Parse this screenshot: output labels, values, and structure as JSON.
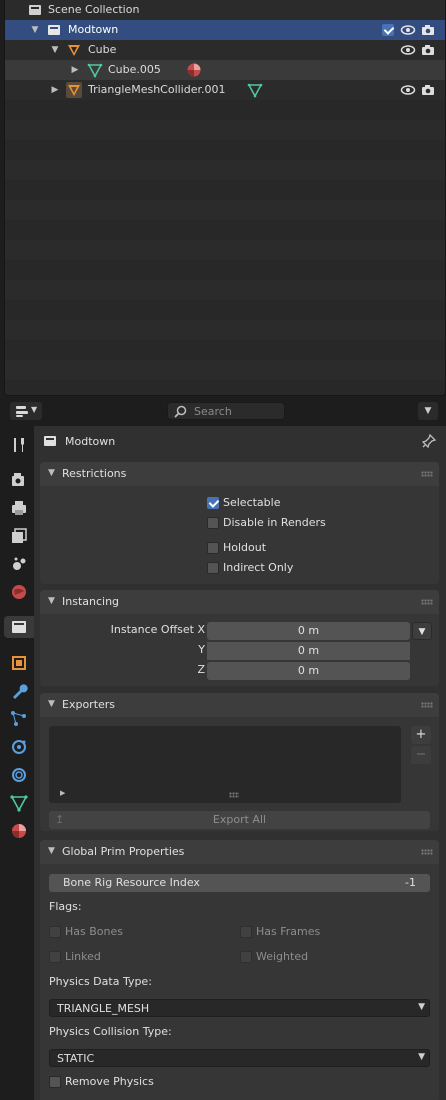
{
  "outliner": {
    "rows": [
      {
        "label": "Scene Collection"
      },
      {
        "label": "Modtown"
      },
      {
        "label": "Cube"
      },
      {
        "label": "Cube.005"
      },
      {
        "label": "TriangleMeshCollider.001"
      }
    ]
  },
  "header": {
    "search_placeholder": "Search"
  },
  "properties": {
    "context_title": "Modtown",
    "restrictions": {
      "title": "Restrictions",
      "selectable": "Selectable",
      "disable_in_renders": "Disable in Renders",
      "holdout": "Holdout",
      "indirect_only": "Indirect Only"
    },
    "instancing": {
      "title": "Instancing",
      "x_label": "Instance Offset X",
      "y_label": "Y",
      "z_label": "Z",
      "x_value": "0 m",
      "y_value": "0 m",
      "z_value": "0 m"
    },
    "exporters": {
      "title": "Exporters",
      "add": "+",
      "remove": "−",
      "export_all": "Export All"
    },
    "global_prim": {
      "title": "Global Prim Properties",
      "bone_rig_label": "Bone Rig Resource Index",
      "bone_rig_value": "-1",
      "flags_label": "Flags:",
      "has_bones": "Has Bones",
      "has_frames": "Has Frames",
      "linked": "Linked",
      "weighted": "Weighted",
      "physics_data_type_label": "Physics Data Type:",
      "physics_data_type_value": "TRIANGLE_MESH",
      "physics_collision_type_label": "Physics Collision Type:",
      "physics_collision_type_value": "STATIC",
      "remove_physics": "Remove Physics"
    }
  },
  "colors": {
    "selected_row": "#334d80",
    "checkbox_checked": "#4772b3",
    "mesh_icon": "#4ec9a0",
    "object_icon": "#e8933a",
    "material_icon": "#c74a4a"
  }
}
